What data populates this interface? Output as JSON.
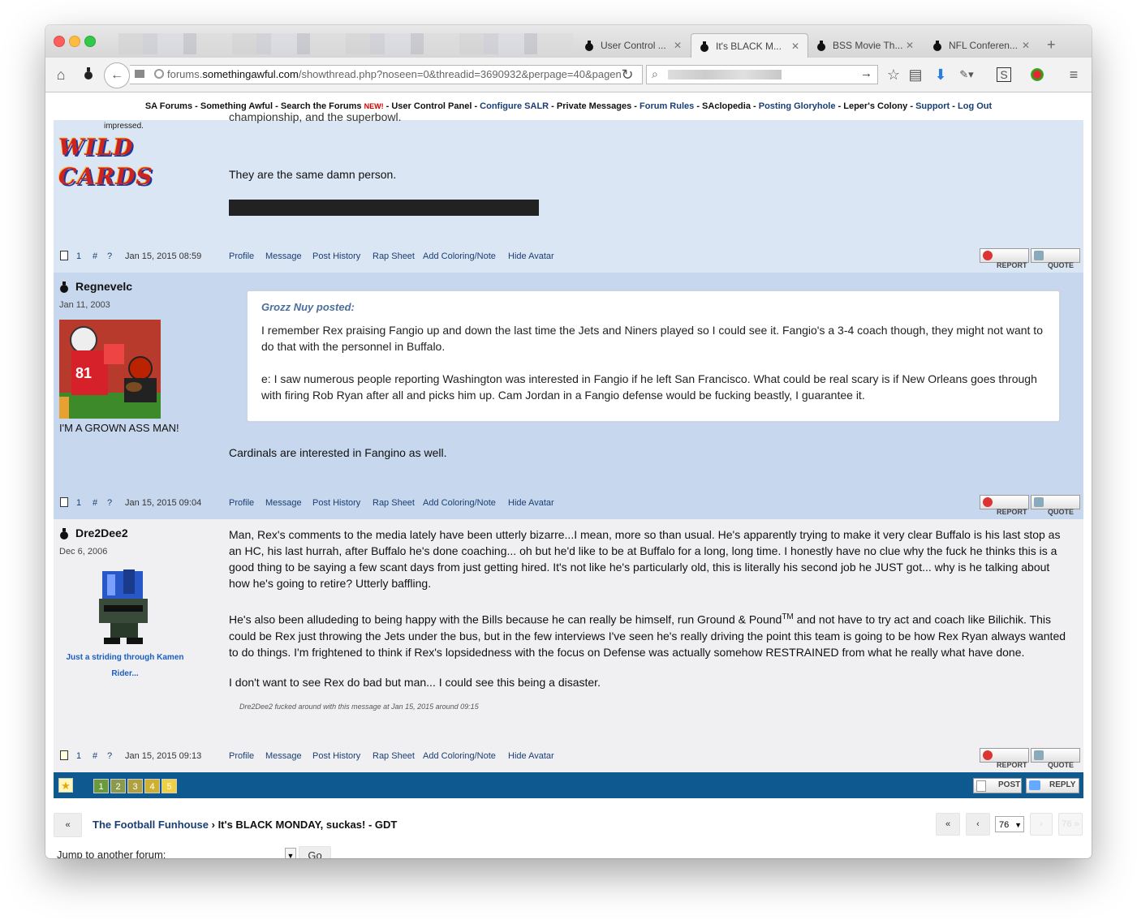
{
  "browser": {
    "tabs": [
      {
        "label": "User Control ..."
      },
      {
        "label": "It's BLACK M..."
      },
      {
        "label": "BSS Movie Th..."
      },
      {
        "label": "NFL Conferen..."
      }
    ],
    "new_tab": "+",
    "url_prefix": "forums.",
    "url_domain": "somethingawful.com",
    "url_path": "/showthread.php?noseen=0&threadid=3690932&perpage=40&pagen"
  },
  "forum_nav": {
    "items": [
      "SA Forums",
      "Something Awful",
      "Search the Forums",
      "User Control Panel",
      "Configure SALR",
      "Private Messages",
      "Forum Rules",
      "SAclopedia",
      "Posting Gloryhole",
      "Leper's Colony",
      "Support",
      "Log Out"
    ],
    "new_badge": "NEW!",
    "sep": " - "
  },
  "post_actions": {
    "profile": "Profile",
    "message": "Message",
    "post_history": "Post History",
    "rap_sheet": "Rap Sheet",
    "add_coloring": "Add Coloring/Note",
    "hide_avatar": "Hide Avatar",
    "report": "REPORT",
    "quote": "QUOTE",
    "one": "1",
    "hash": "#",
    "question": "?"
  },
  "post1": {
    "title_text": "impressed.",
    "avatar_text": "WILD CARDS",
    "line_partial": "championship, and the superbowl.",
    "body": "They are the same damn person.",
    "timestamp": "Jan 15, 2015 08:59"
  },
  "post2": {
    "username": "Regnevelc",
    "regdate": "Jan 11, 2003",
    "title_text": "I'M A GROWN ASS MAN!",
    "quote_author": "Grozz Nuy posted:",
    "quote_p1": "I remember Rex praising Fangio up and down the last time the Jets and Niners played so I could see it. Fangio's a 3-4 coach though, they might not want to do that with the personnel in Buffalo.",
    "quote_p2": "e: I saw numerous people reporting Washington was interested in Fangio if he left San Francisco. What could be real scary is if New Orleans goes through with firing Rob Ryan after all and picks him up. Cam Jordan in a Fangio defense would be fucking beastly, I guarantee it.",
    "body": "Cardinals are interested in Fangino as well.",
    "timestamp": "Jan 15, 2015 09:04"
  },
  "post3": {
    "username": "Dre2Dee2",
    "regdate": "Dec 6, 2006",
    "title_text": "Just a striding through Kamen Rider...",
    "p1": "Man, Rex's comments to the media lately have been utterly bizarre...I mean, more so than usual. He's apparently trying to make it very clear Buffalo is his last stop as an HC, his last hurrah, after Buffalo he's done coaching... oh but he'd like to be at Buffalo for a long, long time. I honestly have no clue why the fuck he thinks this is a good thing to be saying a few scant days from just getting hired. It's not like he's particularly old, this is literally his second job he JUST got... why is he talking about how he's going to retire? Utterly baffling.",
    "p2a": "He's also been alludeding to being happy with the Bills because he can really be himself, run Ground & Pound",
    "p2_tm": "TM",
    "p2b": " and not have to try act and coach like Bilichik. This could be Rex just throwing the Jets under the bus, but in the few interviews I've seen he's really driving the point this team is going to be how Rex Ryan always wanted to do things. I'm frightened to think if Rex's lopsidedness with the focus on Defense was actually somehow RESTRAINED from what he really what have done.",
    "p3": "I don't want to see Rex do bad but man... I could see this being a disaster.",
    "edit_note": "Dre2Dee2 fucked around with this message at Jan 15, 2015 around 09:15",
    "timestamp": "Jan 15, 2015 09:13"
  },
  "bottom": {
    "pages": [
      "1",
      "2",
      "3",
      "4",
      "5"
    ],
    "post_label": "POST",
    "reply_label": "REPLY"
  },
  "footer": {
    "first": "«",
    "forum_link": "The Football Funhouse",
    "crumb_sep": " › ",
    "thread_title": "It's BLACK MONDAY, suckas! - GDT",
    "prev_first": "«",
    "prev": "‹",
    "page_num": "76",
    "next": "›",
    "last": "76 »",
    "jump_label": "Jump to another forum:",
    "go_label": "Go"
  },
  "colors": {
    "post_bg_blue": "#dbe6f4",
    "post_bg_blue2": "#c7d7ee",
    "post_bg_grey": "#f0f0f3",
    "link_blue": "#1a3f73",
    "bar_blue": "#0e5a90",
    "quote_author": "#4b6f9c"
  }
}
